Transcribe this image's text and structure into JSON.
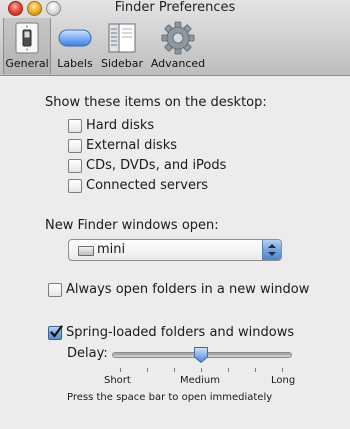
{
  "window": {
    "title": "Finder Preferences"
  },
  "toolbar": {
    "items": [
      {
        "label": "General",
        "icon": "light-switch-icon",
        "selected": true
      },
      {
        "label": "Labels",
        "icon": "label-pill-icon",
        "selected": false
      },
      {
        "label": "Sidebar",
        "icon": "sidebar-list-icon",
        "selected": false
      },
      {
        "label": "Advanced",
        "icon": "gear-icon",
        "selected": false
      }
    ]
  },
  "desktop_section": {
    "heading": "Show these items on the desktop:",
    "items": [
      {
        "label": "Hard disks",
        "checked": false
      },
      {
        "label": "External disks",
        "checked": false
      },
      {
        "label": "CDs, DVDs, and iPods",
        "checked": false
      },
      {
        "label": "Connected servers",
        "checked": false
      }
    ]
  },
  "new_window": {
    "label": "New Finder windows open:",
    "selected": "mini",
    "icon": "disk-drive-icon"
  },
  "always_open": {
    "label": "Always open folders in a new window",
    "checked": false
  },
  "spring_loaded": {
    "label": "Spring-loaded folders and windows",
    "checked": true,
    "delay_label": "Delay:",
    "tick_labels": [
      "Short",
      "Medium",
      "Long"
    ],
    "value_fraction": 0.5,
    "hint": "Press the space bar to open immediately"
  },
  "colors": {
    "selection_blue": "#5a8fd0",
    "window_bg": "#ececec"
  }
}
